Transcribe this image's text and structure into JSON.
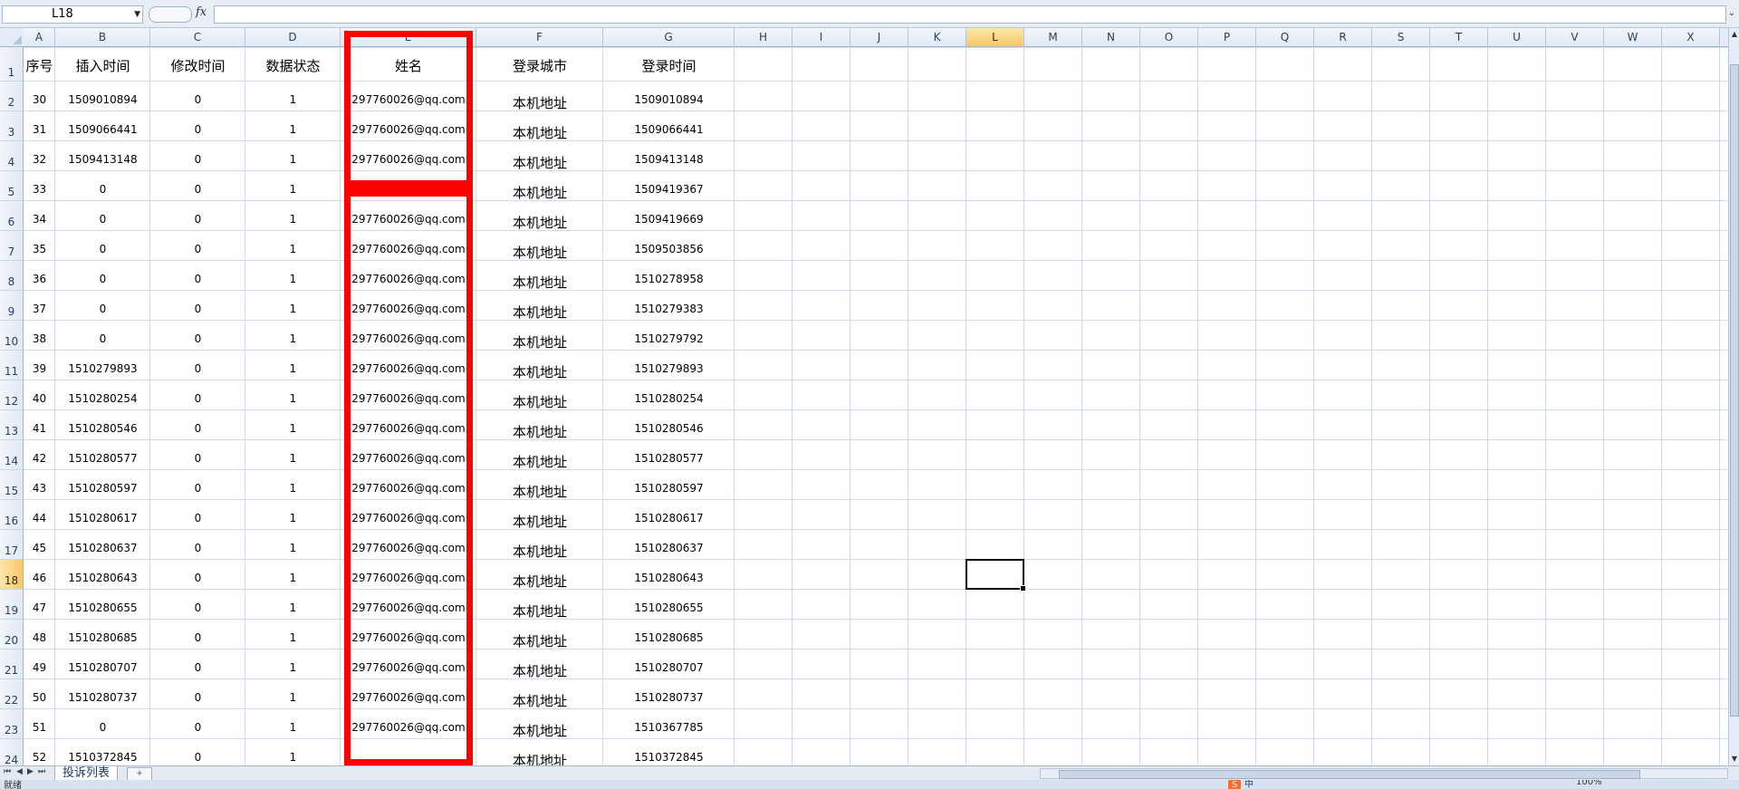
{
  "formula_bar": {
    "name_box": "L18",
    "fx_label": "fx",
    "formula": ""
  },
  "columns": [
    {
      "label": "A",
      "selected": false
    },
    {
      "label": "B",
      "selected": false
    },
    {
      "label": "C",
      "selected": false
    },
    {
      "label": "D",
      "selected": false
    },
    {
      "label": "E",
      "selected": false
    },
    {
      "label": "F",
      "selected": false
    },
    {
      "label": "G",
      "selected": false
    },
    {
      "label": "H",
      "selected": false
    },
    {
      "label": "I",
      "selected": false
    },
    {
      "label": "J",
      "selected": false
    },
    {
      "label": "K",
      "selected": false
    },
    {
      "label": "L",
      "selected": true
    },
    {
      "label": "M",
      "selected": false
    },
    {
      "label": "N",
      "selected": false
    },
    {
      "label": "O",
      "selected": false
    },
    {
      "label": "P",
      "selected": false
    },
    {
      "label": "Q",
      "selected": false
    },
    {
      "label": "R",
      "selected": false
    },
    {
      "label": "S",
      "selected": false
    },
    {
      "label": "T",
      "selected": false
    },
    {
      "label": "U",
      "selected": false
    },
    {
      "label": "V",
      "selected": false
    },
    {
      "label": "W",
      "selected": false
    },
    {
      "label": "X",
      "selected": false
    }
  ],
  "header_row": [
    "序号",
    "插入时间",
    "修改时间",
    "数据状态",
    "姓名",
    "登录城市",
    "登录时间"
  ],
  "rows": [
    [
      "30",
      "1509010894",
      "0",
      "1",
      "297760026@qq.com",
      "本机地址",
      "1509010894"
    ],
    [
      "31",
      "1509066441",
      "0",
      "1",
      "297760026@qq.com",
      "本机地址",
      "1509066441"
    ],
    [
      "32",
      "1509413148",
      "0",
      "1",
      "297760026@qq.com",
      "本机地址",
      "1509413148"
    ],
    [
      "33",
      "0",
      "0",
      "1",
      "",
      "本机地址",
      "1509419367"
    ],
    [
      "34",
      "0",
      "0",
      "1",
      "297760026@qq.com",
      "本机地址",
      "1509419669"
    ],
    [
      "35",
      "0",
      "0",
      "1",
      "297760026@qq.com",
      "本机地址",
      "1509503856"
    ],
    [
      "36",
      "0",
      "0",
      "1",
      "297760026@qq.com",
      "本机地址",
      "1510278958"
    ],
    [
      "37",
      "0",
      "0",
      "1",
      "297760026@qq.com",
      "本机地址",
      "1510279383"
    ],
    [
      "38",
      "0",
      "0",
      "1",
      "297760026@qq.com",
      "本机地址",
      "1510279792"
    ],
    [
      "39",
      "1510279893",
      "0",
      "1",
      "297760026@qq.com",
      "本机地址",
      "1510279893"
    ],
    [
      "40",
      "1510280254",
      "0",
      "1",
      "297760026@qq.com",
      "本机地址",
      "1510280254"
    ],
    [
      "41",
      "1510280546",
      "0",
      "1",
      "297760026@qq.com",
      "本机地址",
      "1510280546"
    ],
    [
      "42",
      "1510280577",
      "0",
      "1",
      "297760026@qq.com",
      "本机地址",
      "1510280577"
    ],
    [
      "43",
      "1510280597",
      "0",
      "1",
      "297760026@qq.com",
      "本机地址",
      "1510280597"
    ],
    [
      "44",
      "1510280617",
      "0",
      "1",
      "297760026@qq.com",
      "本机地址",
      "1510280617"
    ],
    [
      "45",
      "1510280637",
      "0",
      "1",
      "297760026@qq.com",
      "本机地址",
      "1510280637"
    ],
    [
      "46",
      "1510280643",
      "0",
      "1",
      "297760026@qq.com",
      "本机地址",
      "1510280643"
    ],
    [
      "47",
      "1510280655",
      "0",
      "1",
      "297760026@qq.com",
      "本机地址",
      "1510280655"
    ],
    [
      "48",
      "1510280685",
      "0",
      "1",
      "297760026@qq.com",
      "本机地址",
      "1510280685"
    ],
    [
      "49",
      "1510280707",
      "0",
      "1",
      "297760026@qq.com",
      "本机地址",
      "1510280707"
    ],
    [
      "50",
      "1510280737",
      "0",
      "1",
      "297760026@qq.com",
      "本机地址",
      "1510280737"
    ],
    [
      "51",
      "0",
      "0",
      "1",
      "297760026@qq.com",
      "本机地址",
      "1510367785"
    ],
    [
      "52",
      "1510372845",
      "0",
      "1",
      "",
      "本机地址",
      "1510372845"
    ]
  ],
  "row_numbers": [
    "1",
    "2",
    "3",
    "4",
    "5",
    "6",
    "7",
    "8",
    "9",
    "10",
    "11",
    "12",
    "13",
    "14",
    "15",
    "16",
    "17",
    "18",
    "19",
    "20",
    "21",
    "22",
    "23",
    "24"
  ],
  "selected_row": "18",
  "active_cell": "L18",
  "sheet_tab": "投诉列表",
  "status": "就绪",
  "ime_label": "中",
  "zoom": "100%",
  "icons": {
    "sheet_nav": [
      "first-sheet-icon",
      "prev-sheet-icon",
      "next-sheet-icon",
      "last-sheet-icon"
    ],
    "insert_sheet": "insert-sheet-icon"
  },
  "colors": {
    "highlight_box": "#ff0000",
    "selected_header": "#f8c86a",
    "grid_line": "#d4dcec"
  }
}
